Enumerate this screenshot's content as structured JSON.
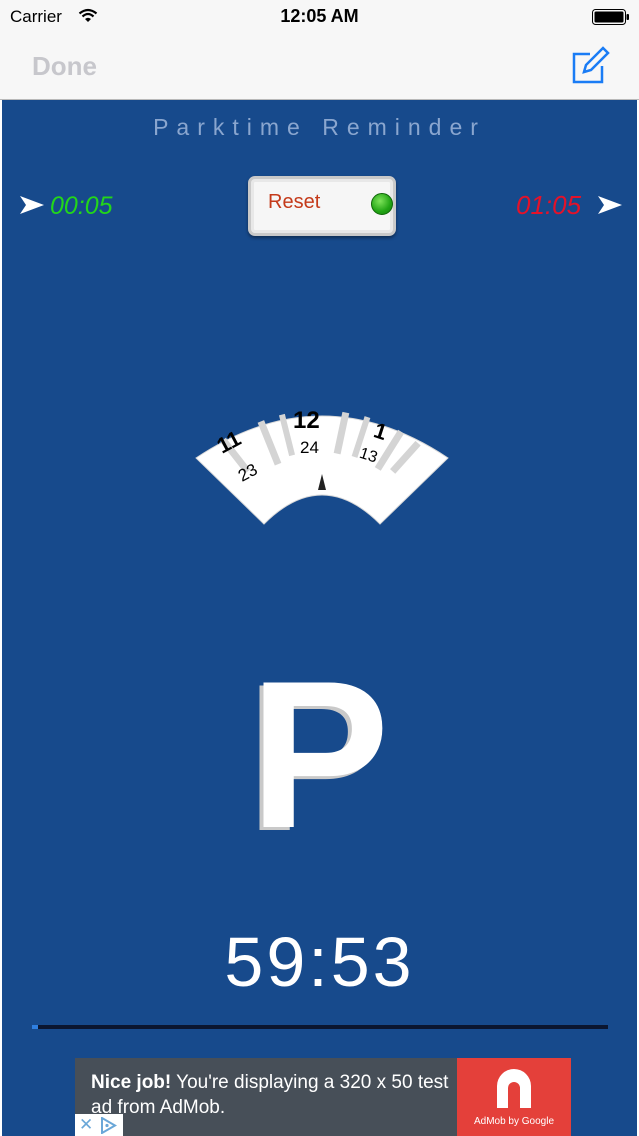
{
  "status_bar": {
    "carrier": "Carrier",
    "time": "12:05 AM",
    "icons": [
      "wifi-icon",
      "battery-icon"
    ]
  },
  "nav_bar": {
    "left_button": "Done",
    "right_icon": "compose-icon"
  },
  "main": {
    "title": "Parktime Reminder",
    "elapsed_time": "00:05",
    "alarm_time": "01:05",
    "reset_label": "Reset",
    "dial_hours": [
      "11",
      "12",
      "1"
    ],
    "dial_hours_24": [
      "23",
      "24",
      "13"
    ],
    "parking_symbol": "P",
    "countdown": "59:53",
    "progress_fraction": 0.01
  },
  "ad": {
    "headline_bold": "Nice job!",
    "headline_rest": " You're displaying a 320 x 50 test ad from AdMob.",
    "logo_label": "AdMob by Google",
    "close_glyph": "✕"
  },
  "colors": {
    "background_blue": "#174a8c",
    "elapsed_green": "#23d61a",
    "alarm_red": "#e4122a",
    "reset_red": "#c43a1a",
    "led_green": "#21a414",
    "ad_red": "#e4403a"
  }
}
